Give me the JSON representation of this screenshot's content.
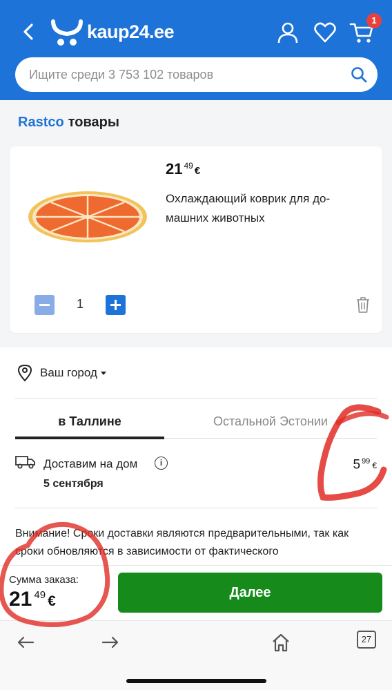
{
  "header": {
    "logo_text": "kaup24.ee",
    "cart_count": "1",
    "brand_color": "#1e73d9",
    "icons": [
      "back-arrow-icon",
      "logo-icon",
      "user-icon",
      "heart-icon",
      "cart-icon"
    ]
  },
  "search": {
    "placeholder": "Ищите среди 3 753 102 товаров",
    "icon": "search-icon"
  },
  "seller": {
    "brand": "Rastco",
    "suffix": "товары"
  },
  "product": {
    "price_int": "21",
    "price_cents": "49",
    "currency": "€",
    "name": "Охлаждающий коврик для до-машних животных",
    "quantity": "1"
  },
  "delivery": {
    "city_label": "Ваш город",
    "tabs": [
      {
        "label": "в Таллине",
        "active": true
      },
      {
        "label": "Остальной Эстонии",
        "active": false
      }
    ],
    "method_label": "Доставим на дом",
    "date": "5 сентября",
    "price_int": "5",
    "price_cents": "99",
    "currency": "€",
    "notice": "Внимание! Сроки доставки являются предварительными, так как сроки обновляются в зависимости от фактического"
  },
  "order": {
    "sum_label": "Сумма заказа:",
    "sum_int": "21",
    "sum_cents": "49",
    "currency": "€",
    "next_label": "Далее",
    "next_color": "#168b1c"
  },
  "browser": {
    "tabs_count": "27",
    "icons": [
      "back-icon",
      "forward-icon",
      "home-icon",
      "tabs-icon"
    ]
  }
}
